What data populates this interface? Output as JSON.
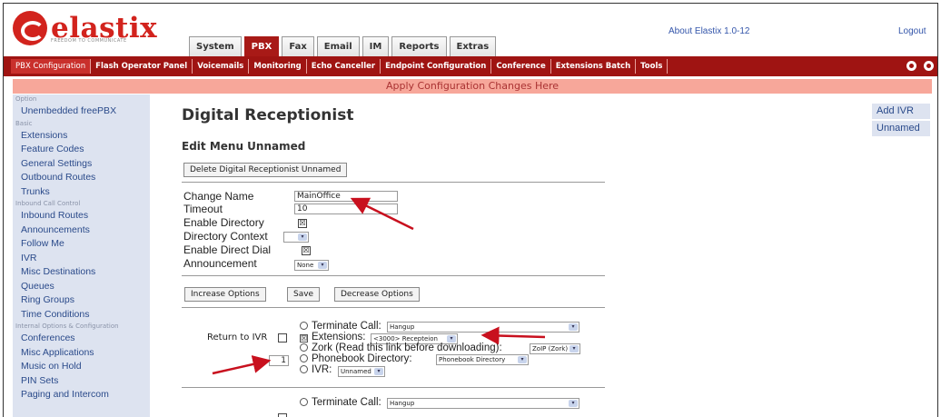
{
  "header": {
    "logo_text": "elastix",
    "logo_tagline": "FREEDOM TO COMMUNICATE",
    "about": "About Elastix 1.0-12",
    "logout": "Logout",
    "tabs": [
      "System",
      "PBX",
      "Fax",
      "Email",
      "IM",
      "Reports",
      "Extras"
    ],
    "active_tab": "PBX"
  },
  "subnav": {
    "items": [
      "PBX Configuration",
      "Flash Operator Panel",
      "Voicemails",
      "Monitoring",
      "Echo Canceller",
      "Endpoint Configuration",
      "Conference",
      "Extensions Batch",
      "Tools"
    ]
  },
  "apply_bar": "Apply Configuration Changes Here",
  "sidebar": {
    "option_head": "Option",
    "unembedded": "Unembedded freePBX",
    "basic_head": "Basic",
    "basic": [
      "Extensions",
      "Feature Codes",
      "General Settings",
      "Outbound Routes",
      "Trunks"
    ],
    "inbound_head": "Inbound Call Control",
    "inbound": [
      "Inbound Routes",
      "Announcements",
      "Follow Me",
      "IVR",
      "Misc Destinations",
      "Queues",
      "Ring Groups",
      "Time Conditions"
    ],
    "internal_head": "Internal Options & Configuration",
    "internal": [
      "Conferences",
      "Misc Applications",
      "Music on Hold",
      "PIN Sets",
      "Paging and Intercom"
    ]
  },
  "main": {
    "title": "Digital Receptionist",
    "subtitle": "Edit Menu Unnamed",
    "delete_button": "Delete Digital Receptionist Unnamed",
    "form": {
      "change_name_label": "Change Name",
      "change_name_value": "MainOffice",
      "timeout_label": "Timeout",
      "timeout_value": "10",
      "enable_directory_label": "Enable Directory",
      "enable_directory_checked": "☒",
      "directory_context_label": "Directory Context",
      "enable_direct_dial_label": "Enable Direct Dial",
      "enable_direct_dial_checked": "☒",
      "announcement_label": "Announcement",
      "announcement_value": "None"
    },
    "buttons": {
      "increase": "Increase Options",
      "save": "Save",
      "decrease": "Decrease Options"
    },
    "option1": {
      "return_to_ivr": "Return to IVR",
      "digit": "1",
      "terminate_label": "Terminate Call:",
      "terminate_value": "Hangup",
      "extensions_label": "Extensions:",
      "extensions_value": "<3000> Recepteion",
      "zork_label": "Zork (Read this link before downloading):",
      "zork_value": "ZoIP (Zork)",
      "phonebook_label": "Phonebook Directory:",
      "phonebook_value": "Phonebook Directory",
      "ivr_label": "IVR:",
      "ivr_value": "Unnamed"
    },
    "option2": {
      "terminate_label": "Terminate Call:",
      "terminate_value": "Hangup"
    }
  },
  "right_panel": {
    "add_ivr": "Add IVR",
    "unnamed": "Unnamed"
  },
  "colors": {
    "brand_red": "#d2231d",
    "nav_red": "#9f1412",
    "apply_bar": "#f7a79a",
    "sidebar_bg": "#dde3f0",
    "annotation_arrow": "#c8101e"
  }
}
